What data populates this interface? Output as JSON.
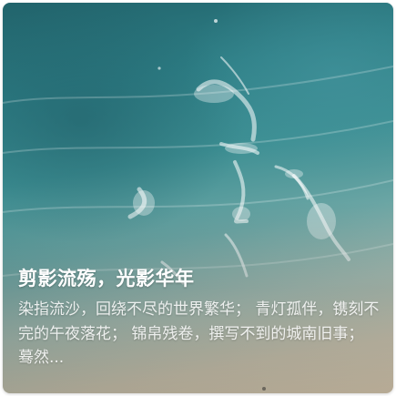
{
  "card": {
    "image": {
      "description_icon": "aerial-beach-photo"
    },
    "title": "剪影流殇，光影华年",
    "description": "染指流沙，回绕不尽的世界繁华； 青灯孤伴，镌刻不完的午夜落花； 锦帛残卷，撰写不到的城南旧事； 蓦然..."
  },
  "colors": {
    "ocean_dark": "#21636b",
    "ocean_mid": "#3d8f93",
    "sand": "#e6d7bd",
    "text": "#ffffff"
  }
}
